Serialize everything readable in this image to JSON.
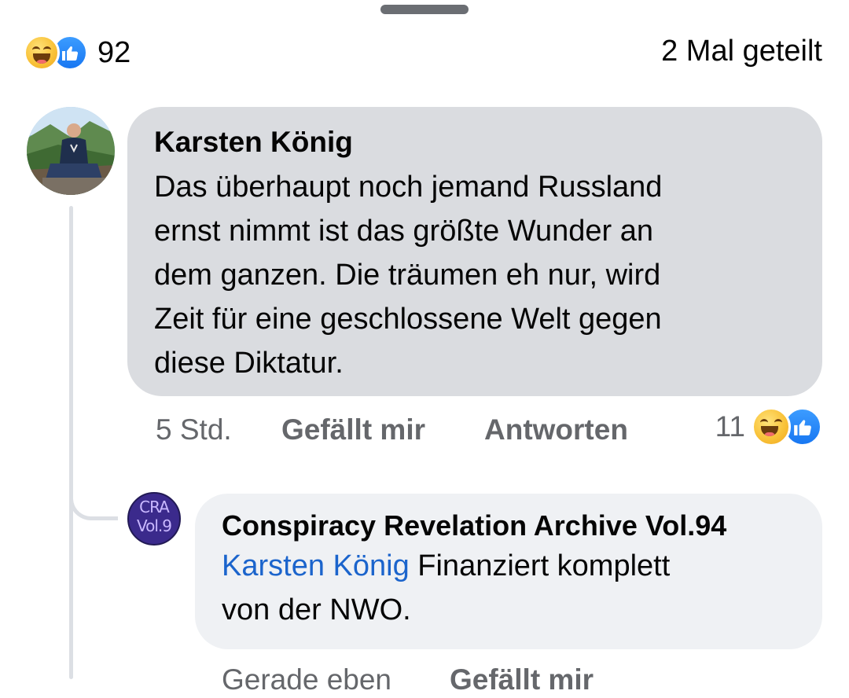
{
  "post_reactions": {
    "count": "92",
    "icons": [
      "haha-icon",
      "like-icon"
    ]
  },
  "shares": "2 Mal geteilt",
  "comment": {
    "author": "Karsten König",
    "text_lines": [
      "Das überhaupt noch jemand Russland",
      "ernst nimmt ist das größte Wunder an",
      "dem ganzen. Die träumen eh nur, wird",
      "Zeit für eine geschlossene Welt gegen",
      "diese Diktatur."
    ],
    "time": "5 Std.",
    "like_label": "Gefällt mir",
    "reply_label": "Antworten",
    "reaction_count": "11"
  },
  "reply": {
    "author": "Conspiracy Revelation Archive Vol.94",
    "avatar_text": [
      "CRA",
      "Vol.9"
    ],
    "mention": "Karsten König",
    "text_line1": " Finanziert komplett",
    "text_line2": "von der NWO.",
    "time": "Gerade eben",
    "like_label": "Gefällt mir"
  },
  "colors": {
    "bubble": "#dadce0",
    "reply_bubble": "#eff1f4",
    "mention": "#1b64cc",
    "meta": "#65676b",
    "like_blue": "#1877f2"
  }
}
